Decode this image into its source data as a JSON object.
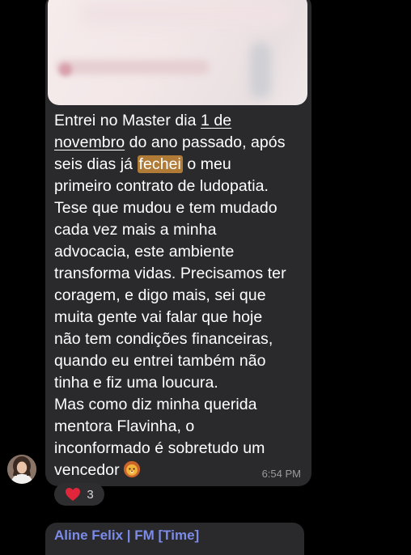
{
  "message": {
    "lines": [
      "Entrei no Master dia ",
      "1 de",
      "novembro",
      " do ano passado, após",
      "seis dias já ",
      "fechei",
      " o meu",
      "primeiro contrato de ludopatia.",
      "Tese que mudou e tem mudado",
      "cada vez mais a minha",
      "advocacia, este ambiente",
      "transforma vidas. Precisamos ter",
      "coragem, e digo mais, sei que",
      "muita gente vai falar que hoje",
      "não tem condições financeiras,",
      "quando eu entrei também não",
      "tinha e fiz uma loucura.",
      "Mas como diz minha querida",
      "mentora Flavinha, o",
      "inconformado é sobretudo um",
      "vencedor"
    ],
    "time": "6:54 PM",
    "emoji_icon": "lion-face-icon"
  },
  "reaction": {
    "icon": "heart-icon",
    "count": "3"
  },
  "next_message": {
    "sender": "Aline Felix | FM [Time]"
  },
  "colors": {
    "background": "#000000",
    "bubble": "#2a2a2c",
    "highlight": "#b07a37",
    "sender_name": "#7c8be8",
    "heart": "#e0263b"
  }
}
